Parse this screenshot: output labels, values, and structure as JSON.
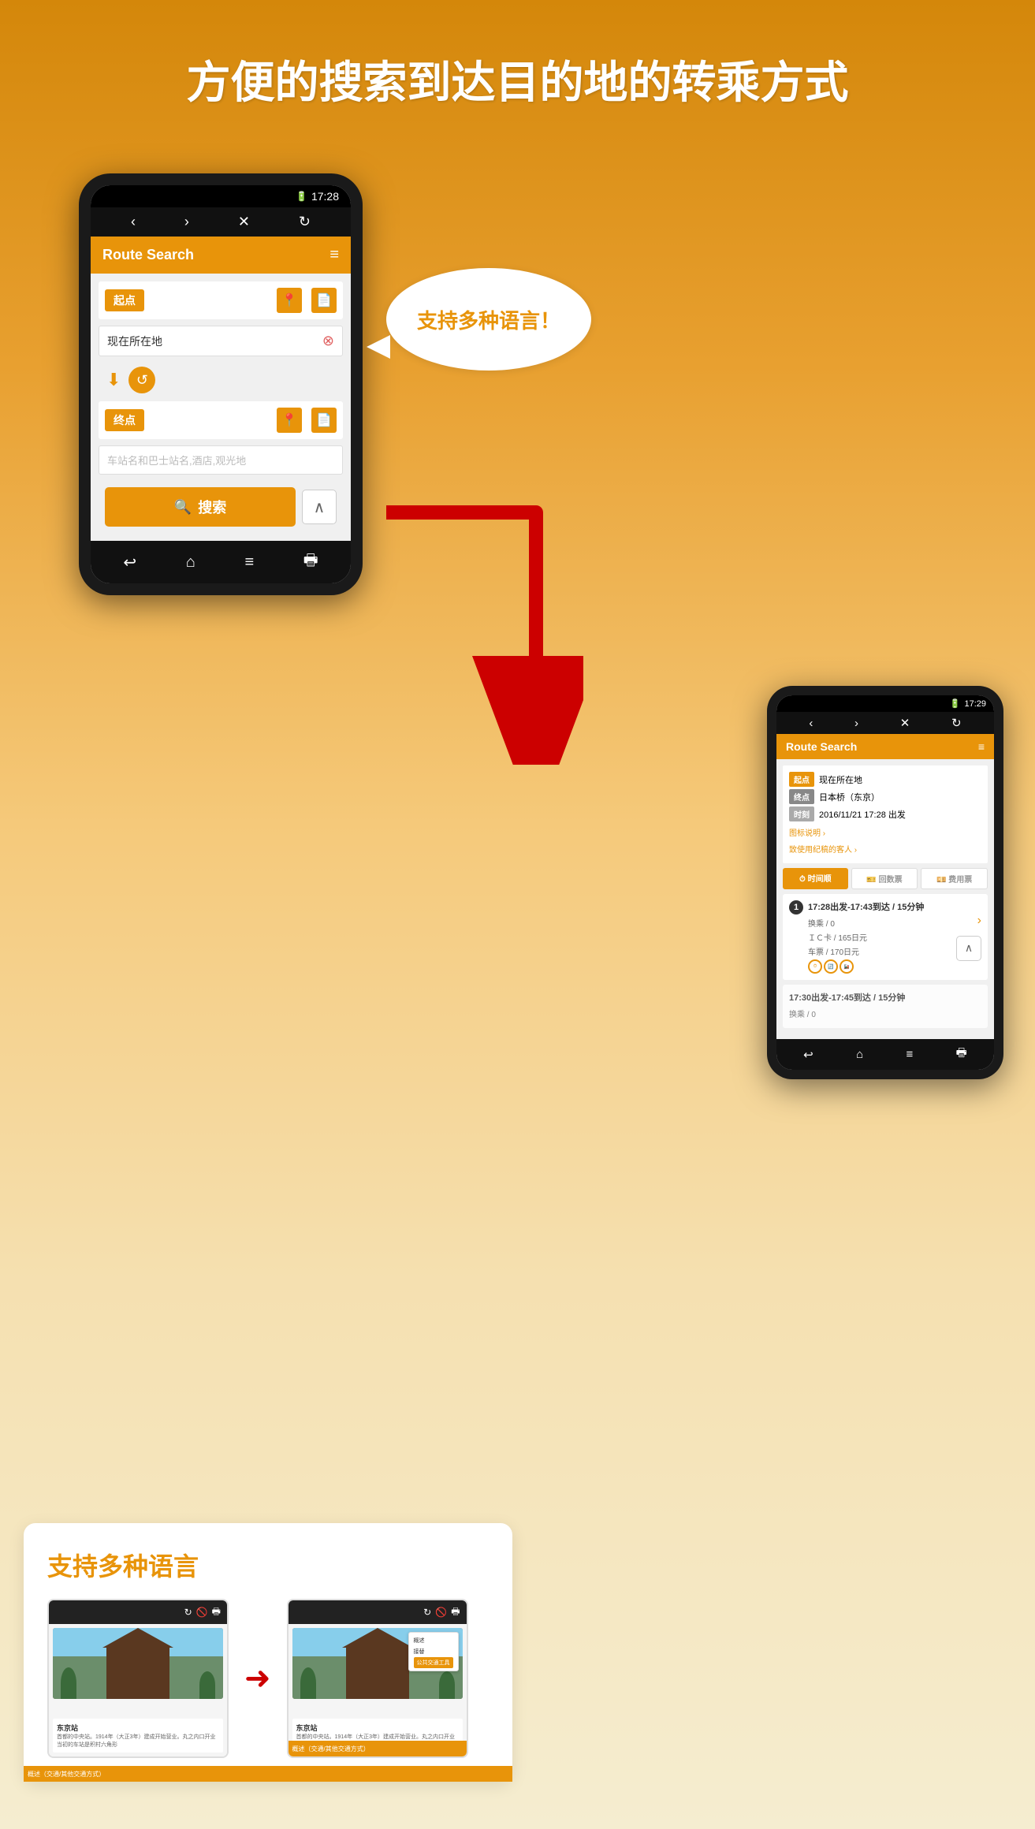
{
  "page": {
    "title": "方便的搜索到达目的地的转乘方式",
    "background_gradient_start": "#D4870A",
    "background_gradient_end": "#F5EDD0"
  },
  "speech_bubble": {
    "text": "支持多种语言！"
  },
  "phone_large": {
    "status_time": "17:28",
    "nav_back": "‹",
    "nav_forward": "›",
    "nav_close": "✕",
    "nav_refresh": "↻",
    "app_title": "Route Search",
    "menu_icon": "≡",
    "start_label": "起点",
    "current_location": "现在所在地",
    "end_label": "终点",
    "destination_placeholder": "车站名和巴士站名,酒店,观光地",
    "search_label": "搜索",
    "bottom_back": "↩",
    "bottom_home": "⌂",
    "bottom_menu": "≡",
    "bottom_print": "🖶"
  },
  "phone_small": {
    "status_time": "17:29",
    "app_title": "Route Search",
    "menu_icon": "≡",
    "start_label": "起点",
    "start_value": "现在所在地",
    "end_label": "终点",
    "end_value": "日本桥（东京）",
    "time_label": "时刻",
    "time_value": "2016/11/21 17:28  出发",
    "legend_link": "图标说明 ›",
    "first_time_link": "致使用纪稿的客人 ›",
    "tab_time": "时间顺",
    "tab_count": "回数票",
    "tab_fare": "费用票",
    "result1_header": "17:28出发-17:43到达 / 15分钟",
    "result1_transfer": "换乘 / 0",
    "result1_ic": "ＩＣ卡  /  165日元",
    "result1_ticket": "车票    /  170日元",
    "result2_header": "17:30出发-17:45到达 / 15分钟",
    "result2_transfer": "换乘 / 0",
    "bottom_back": "↩",
    "bottom_home": "⌂",
    "bottom_menu": "≡",
    "bottom_print": "🖶"
  },
  "bottom_card": {
    "title": "支持多种语言",
    "screenshot1_icons": [
      "↻",
      "🚫",
      "🖶"
    ],
    "screenshot2_icons": [
      "↻",
      "🚫",
      "🖶"
    ],
    "location_name": "东京站",
    "location_desc1": "首都的中央站。1914年（大正3年）建成开始营业。丸之内口开业当初的车站是积村六角形",
    "popup_option1": "概述",
    "popup_option2": "接替",
    "popup_option3_active": "公共交通工具"
  },
  "red_arrow": {
    "color": "#cc0000"
  }
}
